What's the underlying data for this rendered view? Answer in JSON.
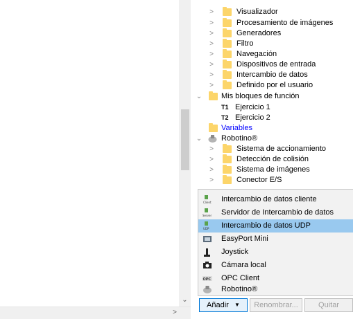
{
  "tree": {
    "items": [
      {
        "label": "Visualizador"
      },
      {
        "label": "Procesamiento de imágenes"
      },
      {
        "label": "Generadores"
      },
      {
        "label": "Filtro"
      },
      {
        "label": "Navegación"
      },
      {
        "label": "Dispositivos de entrada"
      },
      {
        "label": "Intercambio de datos"
      },
      {
        "label": "Definido por el usuario"
      },
      {
        "label": "Mis bloques de función"
      },
      {
        "code": "T1",
        "label": "Ejercicio 1"
      },
      {
        "code": "T2",
        "label": "Ejercicio 2"
      },
      {
        "label": "Variables"
      },
      {
        "label": "Robotino®"
      },
      {
        "label": "Sistema de accionamiento"
      },
      {
        "label": "Detección de colisión"
      },
      {
        "label": "Sistema de imágenes"
      },
      {
        "label": "Conector E/S"
      }
    ],
    "link_color": "#0000ff"
  },
  "menu": {
    "items": [
      {
        "label": "Intercambio de datos cliente",
        "icon": "client-icon"
      },
      {
        "label": "Servidor de Intercambio de datos",
        "icon": "server-icon"
      },
      {
        "label": "Intercambio de datos UDP",
        "icon": "udp-icon",
        "selected": true
      },
      {
        "label": "EasyPort Mini",
        "icon": "easyport-icon"
      },
      {
        "label": "Joystick",
        "icon": "joystick-icon"
      },
      {
        "label": "Cámara local",
        "icon": "camera-icon"
      },
      {
        "label": "OPC Client",
        "icon": "opc-icon"
      },
      {
        "label": "Robotino®",
        "icon": "robotino-icon"
      }
    ],
    "selected_color": "#99c9ef",
    "icon_texts": {
      "client": "Client",
      "server": "Server",
      "udp": "UDP",
      "opc": "OPC"
    }
  },
  "buttons": {
    "add": "Añadir",
    "rename": "Renombrar...",
    "remove": "Quitar"
  }
}
